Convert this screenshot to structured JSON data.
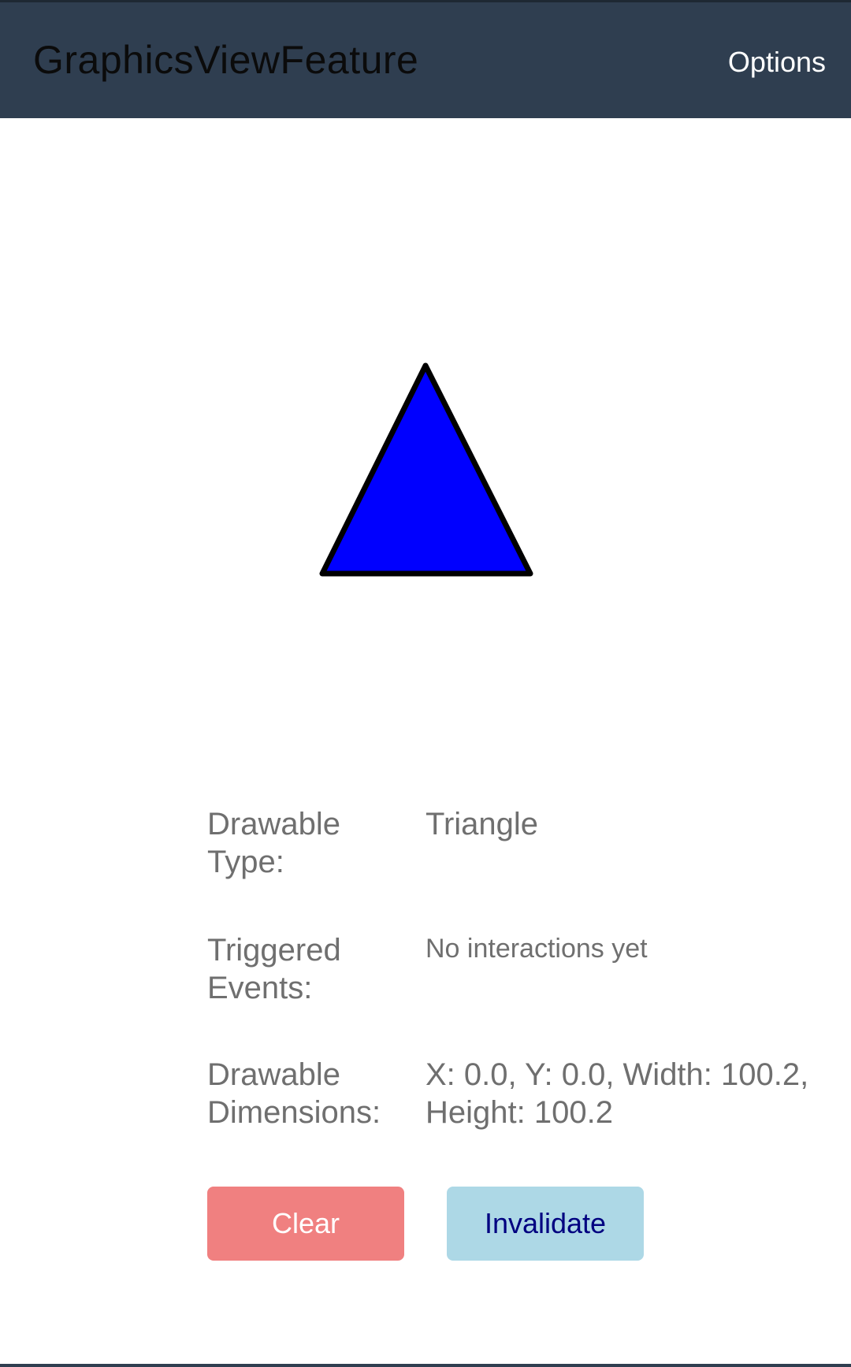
{
  "header": {
    "title": "GraphicsViewFeature",
    "options_label": "Options"
  },
  "canvas": {
    "shape": "triangle",
    "fill_color": "#0000ff",
    "stroke_color": "#000000"
  },
  "info": {
    "drawable_type_label": "Drawable Type:",
    "drawable_type_value": "Triangle",
    "triggered_events_label": "Triggered Events:",
    "triggered_events_value": "No interactions yet",
    "dimensions_label": "Drawable Dimensions:",
    "dimensions_value": "X: 0.0, Y: 0.0, Width: 100.2, Height: 100.2"
  },
  "buttons": {
    "clear_label": "Clear",
    "invalidate_label": "Invalidate"
  },
  "colors": {
    "topbar": "#2f3e50",
    "clear_button": "#f08080",
    "invalidate_button": "#add8e6",
    "invalidate_text": "#000080"
  }
}
